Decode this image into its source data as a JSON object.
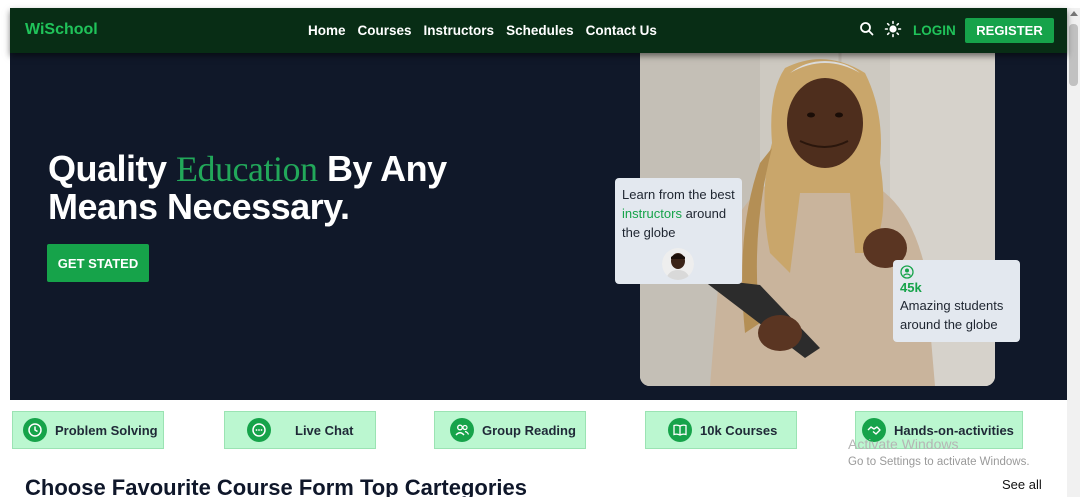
{
  "navbar": {
    "logo": "WiSchool",
    "links": [
      "Home",
      "Courses",
      "Instructors",
      "Schedules",
      "Contact Us"
    ],
    "login": "LOGIN",
    "register": "REGISTER",
    "icons": [
      "search-icon",
      "sun-icon"
    ]
  },
  "hero": {
    "title_part1": "Quality ",
    "title_accent": "Education",
    "title_part2": " By Any Means Necessary.",
    "cta": "GET STATED",
    "card1": {
      "text1": "Learn from the best ",
      "accent": "instructors",
      "text2": " around the globe"
    },
    "card2": {
      "count": "45k",
      "text": "Amazing students around the globe"
    }
  },
  "features": [
    {
      "label": "Problem Solving",
      "icon": "clock-icon"
    },
    {
      "label": "Live Chat",
      "icon": "chat-icon"
    },
    {
      "label": "Group Reading",
      "icon": "users-icon"
    },
    {
      "label": "10k Courses",
      "icon": "book-icon"
    },
    {
      "label": "Hands-on-activities",
      "icon": "handshake-icon"
    }
  ],
  "section": {
    "title": "Choose Favourite Course Form Top Cartegories",
    "see_all": "See all"
  },
  "watermark": {
    "line1": "Activate Windows",
    "line2": "Go to Settings to activate Windows."
  },
  "colors": {
    "nav_bg": "#082d15",
    "hero_bg": "#101829",
    "accent": "#16a34a",
    "chip_bg": "#bbf7d0"
  }
}
